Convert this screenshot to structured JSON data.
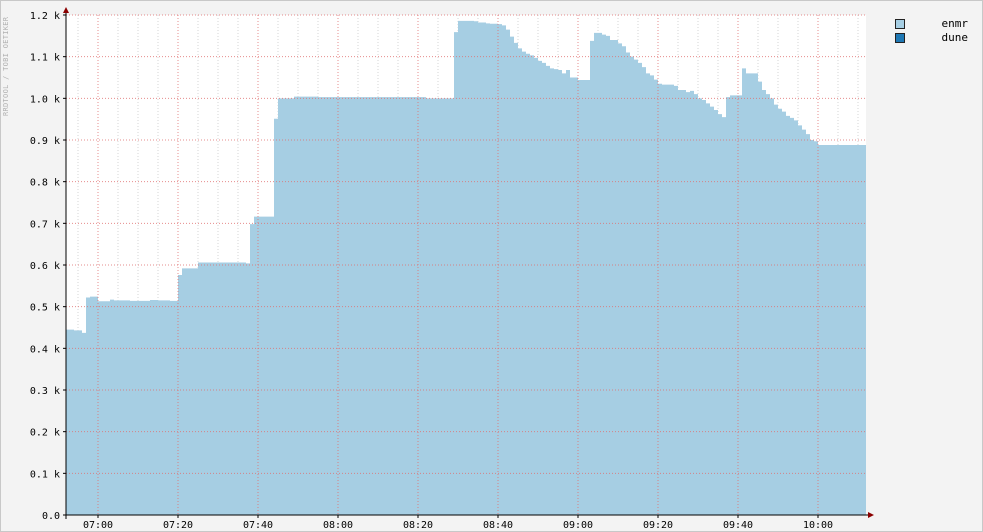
{
  "watermark": "RRDTOOL / TOBI OETIKER",
  "legend": [
    {
      "label": "enmr",
      "color": "#a6cee3"
    },
    {
      "label": "dune",
      "color": "#1f78b4"
    }
  ],
  "colors": {
    "area": "#a6cee3",
    "grid": "#e07070",
    "axis": "#000000",
    "arrow": "#8b0000",
    "background": "#ffffff"
  },
  "chart_data": {
    "type": "area",
    "title": "",
    "xlabel": "",
    "ylabel": "",
    "ylim": [
      0,
      1.2
    ],
    "xlim": [
      "06:52",
      "10:12"
    ],
    "y_unit_suffix": "k",
    "yticks": [
      0.0,
      0.1,
      0.2,
      0.3,
      0.4,
      0.5,
      0.6,
      0.7,
      0.8,
      0.9,
      1.0,
      1.1,
      1.2
    ],
    "ytick_labels": [
      "0.0",
      "0.1 k",
      "0.2 k",
      "0.3 k",
      "0.4 k",
      "0.5 k",
      "0.6 k",
      "0.7 k",
      "0.8 k",
      "0.9 k",
      "1.0 k",
      "1.1 k",
      "1.2 k"
    ],
    "xtick_labels": [
      "07:00",
      "07:20",
      "07:40",
      "08:00",
      "08:20",
      "08:40",
      "09:00",
      "09:20",
      "09:40",
      "10:00"
    ],
    "grid": true,
    "legend_position": "top-right",
    "series": [
      {
        "name": "enmr",
        "x": [
          "06:52",
          "06:53",
          "06:54",
          "06:55",
          "06:56",
          "06:57",
          "06:58",
          "07:00",
          "07:03",
          "07:04",
          "07:08",
          "07:13",
          "07:15",
          "07:18",
          "07:20",
          "07:21",
          "07:24",
          "07:25",
          "07:31",
          "07:37",
          "07:38",
          "07:39",
          "07:40",
          "07:44",
          "07:45",
          "07:47",
          "07:49",
          "07:55",
          "08:08",
          "08:10",
          "08:16",
          "08:20",
          "08:22",
          "08:28",
          "08:29",
          "08:30",
          "08:33",
          "08:34",
          "08:35",
          "08:37",
          "08:38",
          "08:40",
          "08:41",
          "08:42",
          "08:43",
          "08:44",
          "08:45",
          "08:46",
          "08:47",
          "08:48",
          "08:49",
          "08:50",
          "08:51",
          "08:52",
          "08:53",
          "08:54",
          "08:55",
          "08:56",
          "08:57",
          "08:58",
          "09:00",
          "09:01",
          "09:02",
          "09:03",
          "09:04",
          "09:06",
          "09:07",
          "09:08",
          "09:10",
          "09:11",
          "09:12",
          "09:13",
          "09:14",
          "09:15",
          "09:16",
          "09:17",
          "09:18",
          "09:19",
          "09:20",
          "09:21",
          "09:22",
          "09:23",
          "09:24",
          "09:25",
          "09:27",
          "09:28",
          "09:29",
          "09:30",
          "09:31",
          "09:32",
          "09:33",
          "09:34",
          "09:35",
          "09:36",
          "09:37",
          "09:38",
          "09:39",
          "09:40",
          "09:41",
          "09:42",
          "09:45",
          "09:46",
          "09:47",
          "09:48",
          "09:49",
          "09:50",
          "09:51",
          "09:52",
          "09:53",
          "09:54",
          "09:55",
          "09:56",
          "09:57",
          "09:58",
          "09:59",
          "10:00",
          "10:01",
          "10:02",
          "10:03",
          "10:04",
          "10:05",
          "10:06",
          "10:07",
          "10:08",
          "10:12"
        ],
        "values": [
          0.445,
          0.445,
          0.443,
          0.443,
          0.437,
          0.522,
          0.524,
          0.513,
          0.517,
          0.515,
          0.514,
          0.516,
          0.515,
          0.514,
          0.576,
          0.592,
          0.592,
          0.606,
          0.606,
          0.604,
          0.698,
          0.716,
          0.716,
          0.951,
          1.0,
          1.0,
          1.004,
          1.003,
          1.003,
          1.003,
          1.003,
          1.003,
          1.0,
          1.0,
          1.159,
          1.186,
          1.186,
          1.185,
          1.182,
          1.18,
          1.179,
          1.178,
          1.175,
          1.165,
          1.148,
          1.133,
          1.12,
          1.112,
          1.107,
          1.103,
          1.097,
          1.09,
          1.085,
          1.078,
          1.072,
          1.07,
          1.068,
          1.06,
          1.068,
          1.05,
          1.044,
          1.044,
          1.044,
          1.138,
          1.157,
          1.153,
          1.15,
          1.14,
          1.132,
          1.125,
          1.11,
          1.1,
          1.093,
          1.085,
          1.075,
          1.06,
          1.055,
          1.045,
          1.035,
          1.033,
          1.033,
          1.033,
          1.03,
          1.02,
          1.015,
          1.018,
          1.01,
          1.0,
          0.996,
          0.988,
          0.98,
          0.972,
          0.962,
          0.955,
          1.003,
          1.007,
          1.007,
          1.007,
          1.072,
          1.06,
          1.04,
          1.02,
          1.01,
          1.0,
          0.985,
          0.975,
          0.968,
          0.958,
          0.953,
          0.947,
          0.935,
          0.925,
          0.914,
          0.9,
          0.897,
          0.888,
          0.888,
          0.888,
          0.888,
          0.888,
          0.888,
          0.888,
          0.888,
          0.888,
          0.888
        ]
      },
      {
        "name": "dune",
        "x": [
          "06:52",
          "10:12"
        ],
        "values": [
          0.0,
          0.0
        ]
      }
    ]
  }
}
